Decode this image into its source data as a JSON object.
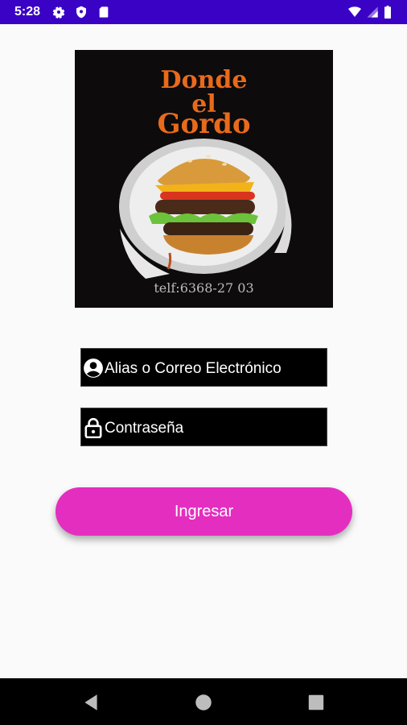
{
  "status_bar": {
    "time": "5:28",
    "background": "#3a02c4",
    "left_icons": [
      "gear-icon",
      "shield-icon",
      "sim-card-icon"
    ],
    "right_icons": [
      "wifi-icon",
      "signal-icon",
      "battery-icon"
    ]
  },
  "logo": {
    "title_line1": "Donde",
    "title_line2": "el",
    "title_line3": "Gordo",
    "phone": "telf:6368-27 03",
    "image_subject": "burger-illustration"
  },
  "form": {
    "username_placeholder": "Alias o Correo Electrónico",
    "username_icon": "account-circle-icon",
    "password_placeholder": "Contraseña",
    "password_icon": "lock-icon"
  },
  "login_button": {
    "label": "Ingresar",
    "color": "#e42ec0"
  },
  "nav_bar": {
    "buttons": [
      "back-icon",
      "home-icon",
      "recents-icon"
    ]
  }
}
